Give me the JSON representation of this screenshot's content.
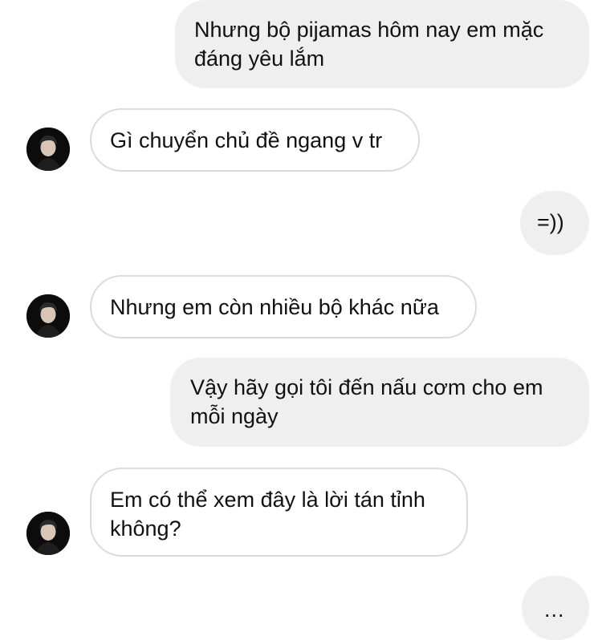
{
  "messages": [
    {
      "sender": "me",
      "text": "Nhưng bộ pijamas hôm nay em mặc\nđáng yêu lắm"
    },
    {
      "sender": "them",
      "text": "Gì chuyển chủ đề ngang v tr"
    },
    {
      "sender": "me",
      "text": "=))"
    },
    {
      "sender": "them",
      "text": "Nhưng em còn nhiều bộ khác nữa"
    },
    {
      "sender": "me",
      "text": "Vậy hãy gọi tôi đến nấu cơm cho em\nmỗi ngày"
    },
    {
      "sender": "them",
      "text": "Em có thể xem đây là lời tán tỉnh\nkhông?"
    },
    {
      "sender": "me",
      "text": "..."
    }
  ],
  "colors": {
    "sent_bubble": "#efefef",
    "received_border": "#dbdbdb",
    "text": "#111111"
  },
  "icons": {
    "avatar": "contact-avatar-photo"
  }
}
